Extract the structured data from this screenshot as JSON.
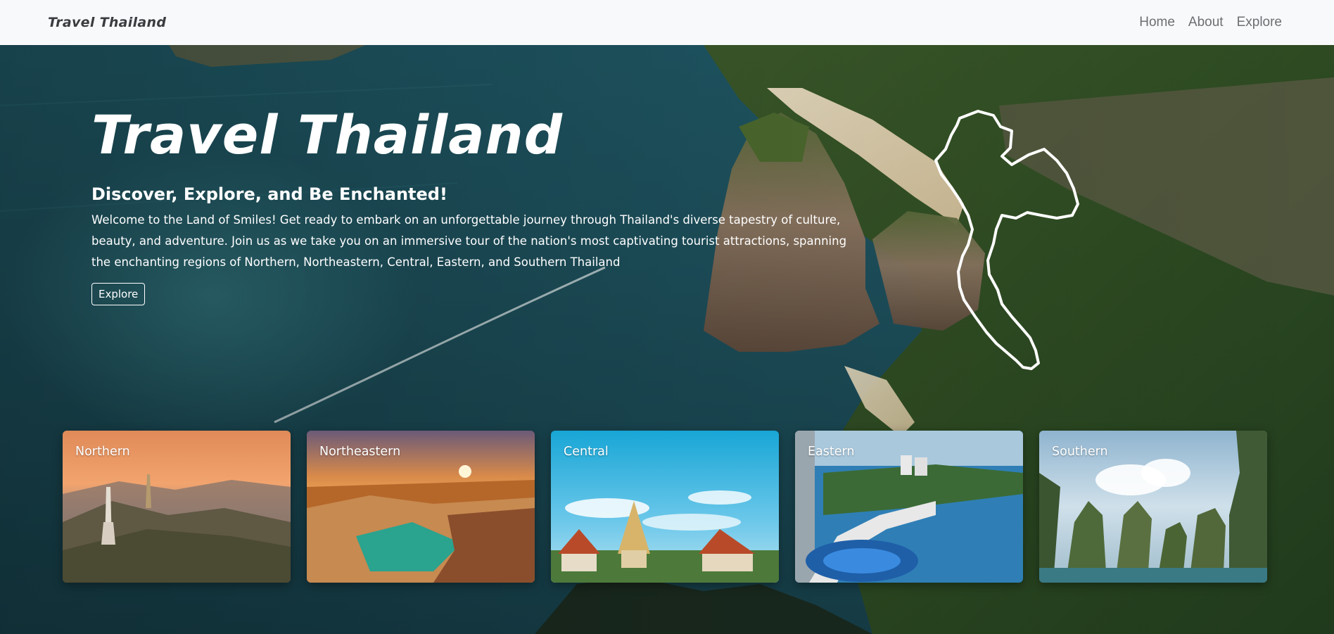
{
  "navbar": {
    "brand": "Travel Thailand",
    "links": [
      "Home",
      "About",
      "Explore"
    ]
  },
  "hero": {
    "title": "Travel Thailand",
    "subtitle": "Discover, Explore, and Be Enchanted!",
    "description": "Welcome to the Land of Smiles! Get ready to embark on an unforgettable journey through Thailand's diverse tapestry of culture, beauty, and adventure. Join us as we take you on an immersive tour of the nation's most captivating tourist attractions, spanning the enchanting regions of Northern, Northeastern, Central, Eastern, and Southern Thailand",
    "button_label": "Explore"
  },
  "regions": [
    {
      "label": "Northern"
    },
    {
      "label": "Northeastern"
    },
    {
      "label": "Central"
    },
    {
      "label": "Eastern"
    },
    {
      "label": "Southern"
    }
  ],
  "icons": {
    "map": "thailand-outline-icon"
  },
  "colors": {
    "navbar_bg": "#f8f9fa",
    "brand_text": "#3a3d40",
    "nav_link": "#6c6f73",
    "hero_text": "#ffffff"
  }
}
